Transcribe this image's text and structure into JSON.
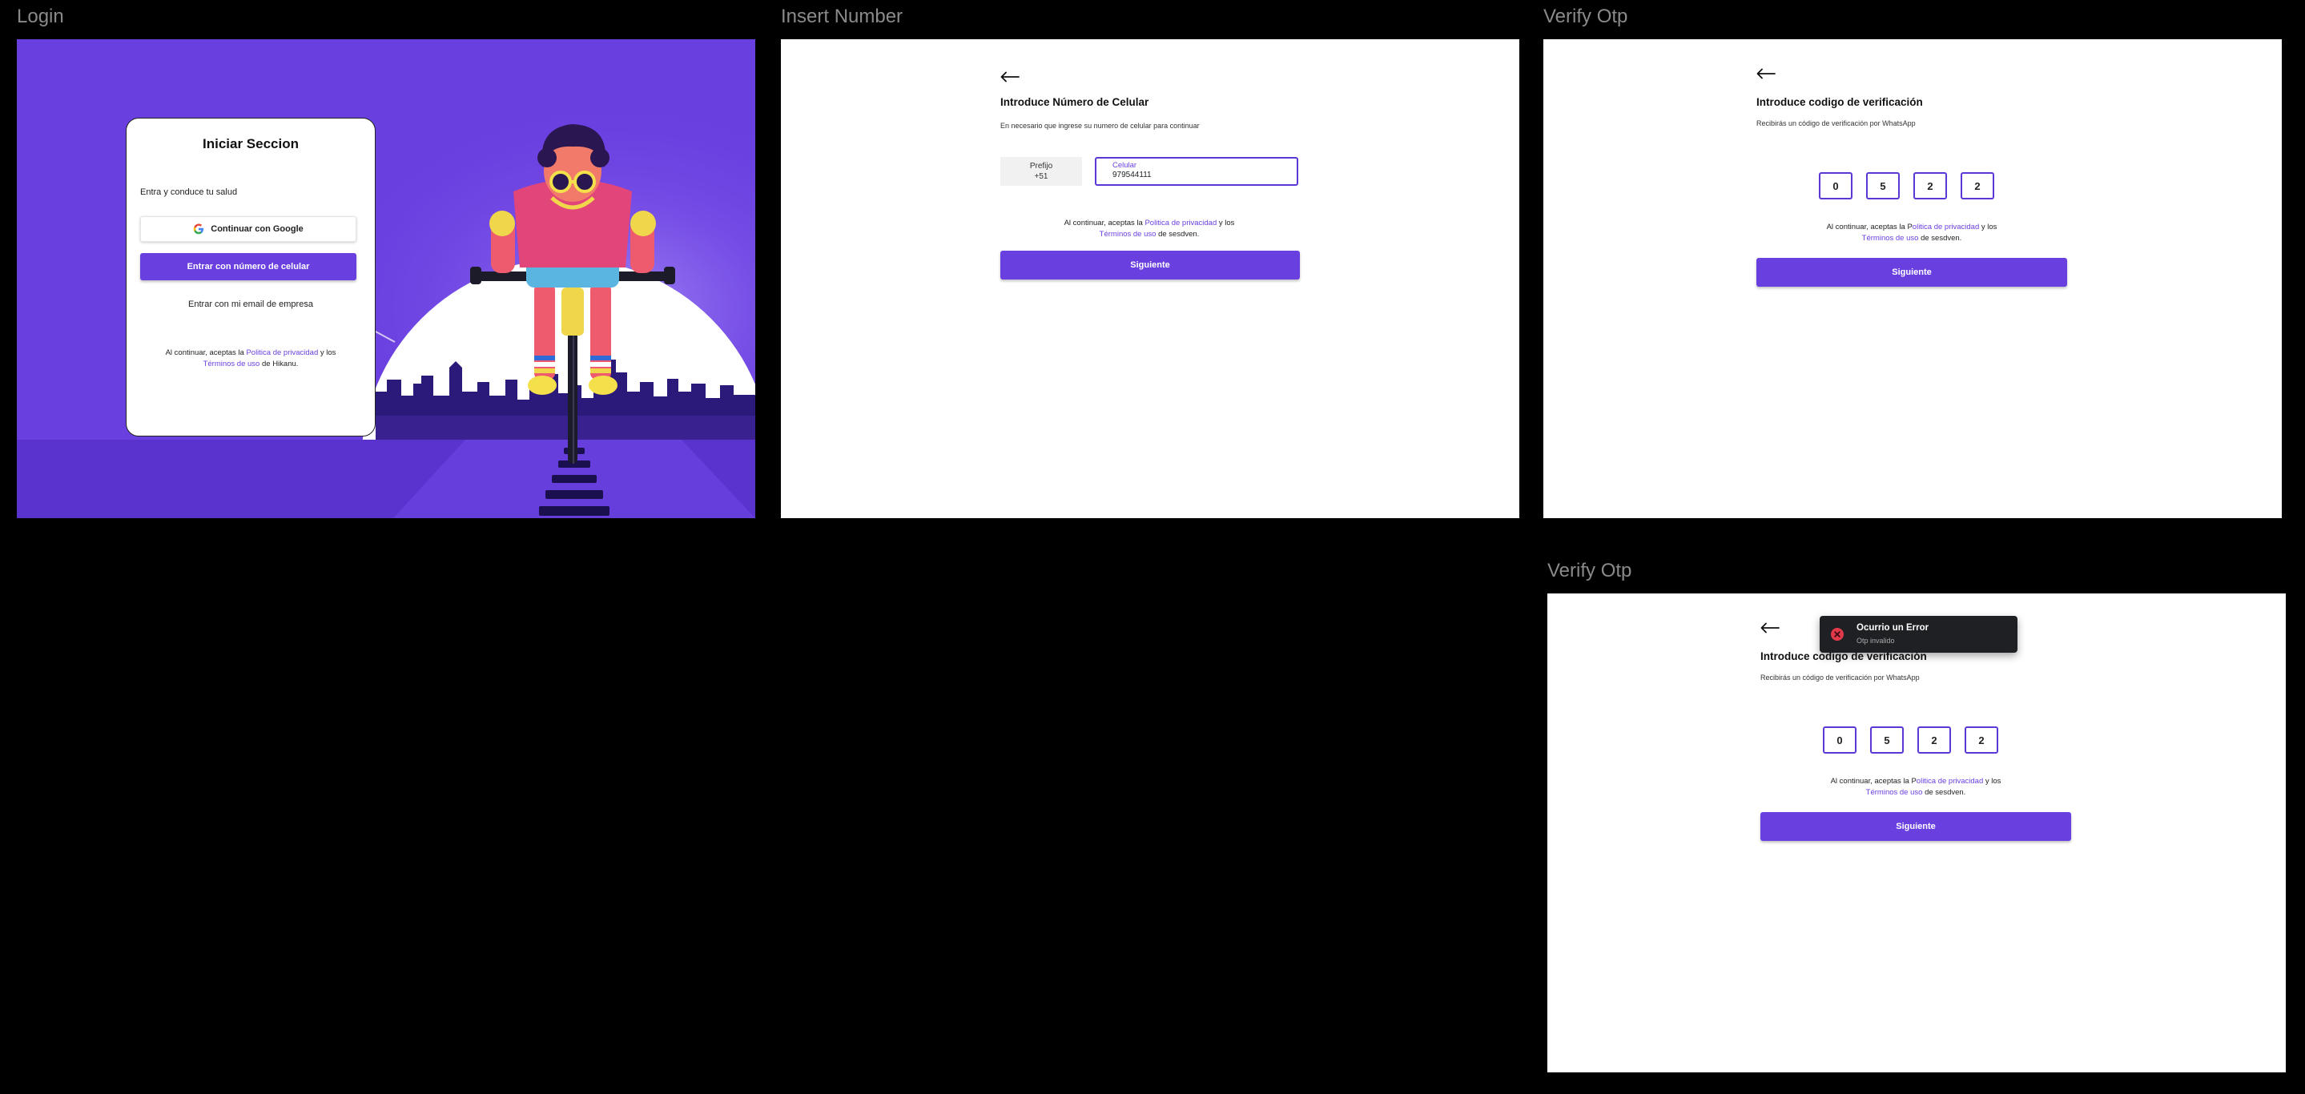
{
  "frames": {
    "login": {
      "label": "Login",
      "card": {
        "title": "Iniciar Seccion",
        "subtitle": "Entra y conduce tu salud",
        "google_button": "Continuar con Google",
        "phone_button": "Entrar con número de celular",
        "email_link": "Entrar con mi email de empresa",
        "terms": {
          "before": "Al continuar, aceptas la ",
          "privacy": "Politica de privacidad",
          "middle": " y los",
          "terms_link": "Términos de uso",
          "after": " de Hikanu."
        }
      }
    },
    "insert_number": {
      "label": "Insert Number",
      "title": "Introduce Número de Celular",
      "subtitle": "En necesario que ingrese su numero  de celular para continuar",
      "prefix_label": "Prefijo",
      "prefix_value": "+51",
      "phone_label": "Celular",
      "phone_value": "979544111",
      "terms": {
        "before": "Al continuar, aceptas la ",
        "privacy": "Politica de privacidad",
        "middle": " y los",
        "terms_link": "Términos de uso",
        "after": " de sesdven."
      },
      "next_button": "Siguiente"
    },
    "verify_otp": {
      "label": "Verify Otp",
      "title": "Introduce codigo de verificación",
      "subtitle": "Recibirás un código de verificación por WhatsApp",
      "otp": [
        "0",
        "5",
        "2",
        "2"
      ],
      "terms": {
        "before": "Al continuar, aceptas la P",
        "privacy": "olitica de privacidad",
        "middle": " y los",
        "terms_link": "Términos de uso",
        "after": " de sesdven."
      },
      "next_button": "Siguiente"
    },
    "verify_otp_error": {
      "label": "Verify Otp",
      "title": "Introduce codigo de verificación",
      "subtitle": "Recibirás un código de verificación por WhatsApp",
      "otp": [
        "0",
        "5",
        "2",
        "2"
      ],
      "terms": {
        "before": "Al continuar, aceptas la P",
        "privacy": "olitica de privacidad",
        "middle": " y los",
        "terms_link": "Términos de uso",
        "after": " de sesdven."
      },
      "next_button": "Siguiente",
      "toast": {
        "title": "Ocurrio un Error",
        "message": "Otp invalido"
      }
    }
  },
  "colors": {
    "canvas": "#000000",
    "primary": "#6a3fe0",
    "input_border": "#5a37d6",
    "toast_bg": "#1f2023",
    "error": "#e03a4a"
  },
  "icons": {
    "back": "arrow-left-icon",
    "google": "google-g-icon",
    "error": "close-circle-icon"
  }
}
